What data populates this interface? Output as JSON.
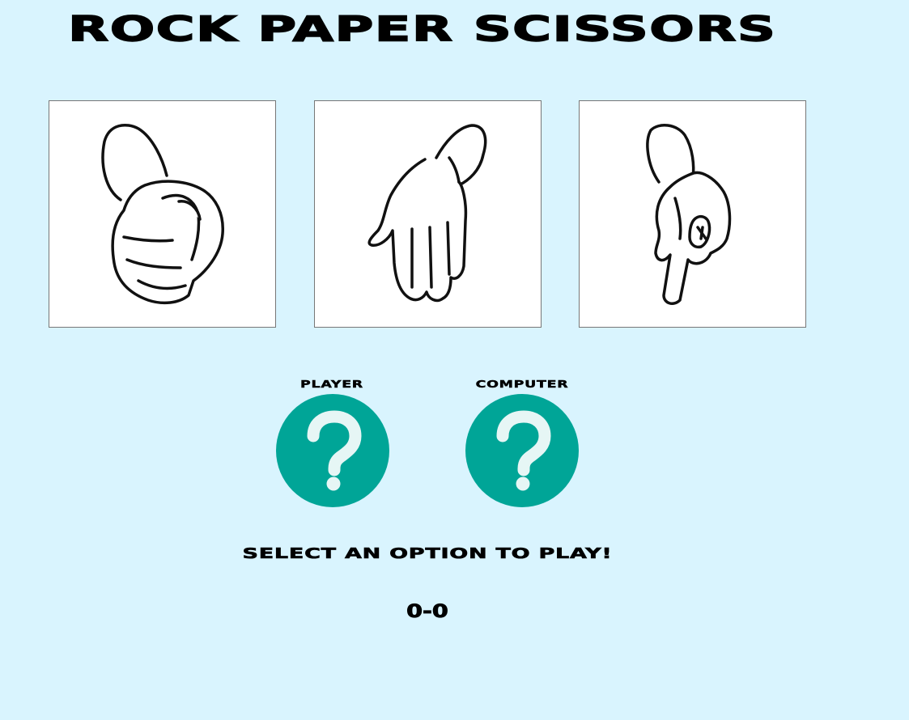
{
  "game": {
    "title": "ROCK PAPER SCISSORS"
  },
  "choices": [
    {
      "id": "rock",
      "icon": "rock-fist-icon"
    },
    {
      "id": "paper",
      "icon": "paper-hand-icon"
    },
    {
      "id": "scissors",
      "icon": "scissors-hand-icon"
    }
  ],
  "arena": {
    "player_label": "PLAYER",
    "computer_label": "COMPUTER",
    "player_icon": "question-mark-icon",
    "computer_icon": "question-mark-icon",
    "circle_color": "#00a597"
  },
  "status": {
    "message": "SELECT AN OPTION TO PLAY!",
    "score": "0-0"
  },
  "colors": {
    "background": "#d9f4fe",
    "card": "#ffffff",
    "text": "#000000"
  }
}
